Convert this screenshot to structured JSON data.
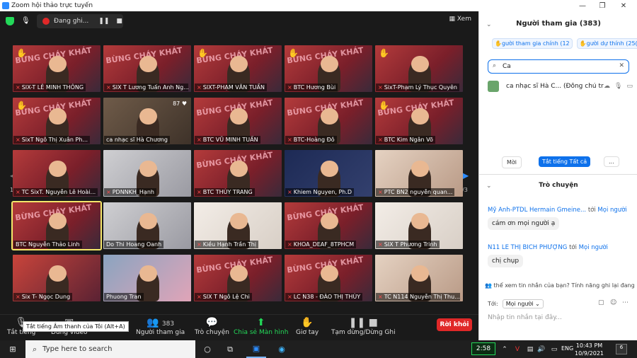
{
  "window": {
    "title": "Zoom hội thảo trực tuyến"
  },
  "topbar": {
    "recording_label": "Đang ghi...",
    "view_label": "Xem"
  },
  "grid": {
    "page_left": "1/3",
    "page_right": "1/3"
  },
  "tiles": [
    {
      "name": "SIX-T LÊ MINH THÔNG",
      "hand": true,
      "muted": true
    },
    {
      "name": "SIX T Lương Tuấn Anh Ng...",
      "hand": false,
      "muted": true
    },
    {
      "name": "SIXT-PHẠM VĂN TUẤN",
      "hand": true,
      "muted": true
    },
    {
      "name": "BTC Hương Bùi",
      "hand": true,
      "muted": true
    },
    {
      "name": "SixT-Phạm Lý Thục Quyên",
      "hand": true,
      "muted": true
    },
    {
      "name": "SixT Ngô Thị Xuân Ph...",
      "hand": true,
      "muted": true
    },
    {
      "name": "ca nhạc sĩ Hà Chương",
      "hand": false,
      "muted": false
    },
    {
      "name": "BTC VŨ MINH TUẤN",
      "hand": false,
      "muted": true
    },
    {
      "name": "BTC-Hoàng Đô",
      "hand": false,
      "muted": true
    },
    {
      "name": "BTC Kim Ngân Võ",
      "hand": true,
      "muted": true
    },
    {
      "name": "TC SixT. Nguyễn Lê Hoài...",
      "hand": false,
      "muted": true
    },
    {
      "name": "PDNNKH_Hạnh",
      "hand": false,
      "muted": true
    },
    {
      "name": "BTC THÙY TRANG",
      "hand": false,
      "muted": true
    },
    {
      "name": "Khiem Nguyen, Ph.D",
      "hand": false,
      "muted": true
    },
    {
      "name": "PTC BN2 nguyễn quan...",
      "hand": false,
      "muted": true
    },
    {
      "name": "BTC Nguyễn Thảo Linh",
      "hand": false,
      "muted": false
    },
    {
      "name": "Do Thi Hoang Oanh",
      "hand": false,
      "muted": false
    },
    {
      "name": "Kiều Hạnh Trần Thị",
      "hand": false,
      "muted": true
    },
    {
      "name": "KHOA_DEAF_8TPHCM",
      "hand": false,
      "muted": true
    },
    {
      "name": "SIX T Phương Trinh",
      "hand": false,
      "muted": true
    },
    {
      "name": "Six T- Ngọc Dung",
      "hand": false,
      "muted": true
    },
    {
      "name": "Phuong Tran",
      "hand": false,
      "muted": false
    },
    {
      "name": "SIX T Ngô Lệ Chi",
      "hand": false,
      "muted": true
    },
    {
      "name": "LC N38 - ĐÀO THỊ THÙY",
      "hand": false,
      "muted": true
    },
    {
      "name": "TC N114 Nguyễn Thị Thu...",
      "hand": false,
      "muted": true
    }
  ],
  "tile_banner": "BỪNG CHÁY KHÁT",
  "tile_badge": "87",
  "toolbar": {
    "unmute": "Tắt tiếng",
    "video": "Dừng video",
    "participants": "Người tham gia",
    "participants_count": "383",
    "chat": "Trò chuyện",
    "share": "Chia sẻ Màn hình",
    "raise_hand": "Giơ tay",
    "pause": "Tạm dừng/Dừng Ghi",
    "leave": "Rời khỏi",
    "tooltip": "Tắt tiếng Âm thanh của Tôi (Alt+A)"
  },
  "participants_panel": {
    "title": "Người tham gia (383)",
    "tab_panelists": "gười tham gia chính (12",
    "tab_attendees": "gười dự thính (25(",
    "search_value": "Ca",
    "participant": "ca nhạc sĩ Hà C... (Đồng chủ trì)",
    "invite": "Mời",
    "mute_all": "Tắt tiếng Tất cả",
    "more": "..."
  },
  "chat": {
    "title": "Trò chuyện",
    "messages": [
      {
        "from": "Mỹ Anh-PTDL Hermain Gmeine...",
        "to_word": "tới",
        "to": "Mọi người",
        "text": "cám ơn mọi người ạ"
      },
      {
        "from": "N11 LÊ THỊ BÍCH PHƯỢNG",
        "to_word": "tới",
        "to": "Mọi người",
        "text": "chị chụp"
      }
    ],
    "notice": "thể xem tin nhắn của bạn? Tính năng ghi lại đang đư",
    "to_label": "Tới:",
    "to_value": "Mọi người",
    "input_placeholder": "Nhập tin nhắn tại đây..."
  },
  "taskbar": {
    "search_placeholder": "Type here to search",
    "timer": "2:58",
    "lang": "ENG",
    "time": "10:43 PM",
    "date": "10/9/2021",
    "notif_count": "6"
  }
}
